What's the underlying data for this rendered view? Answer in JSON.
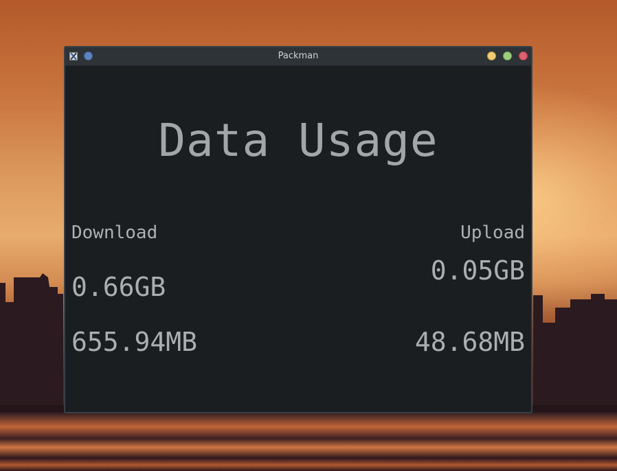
{
  "window": {
    "title": "Packman"
  },
  "main": {
    "heading": "Data Usage",
    "download": {
      "label": "Download",
      "gb": "0.66GB",
      "mb": "655.94MB"
    },
    "upload": {
      "label": "Upload",
      "gb": "0.05GB",
      "mb": "48.68MB"
    }
  },
  "icons": {
    "app": "app-icon",
    "pin": "pin-icon",
    "minimize": "minimize-icon",
    "maximize": "maximize-icon",
    "close": "close-icon"
  },
  "colors": {
    "window_bg": "#1b1e21",
    "titlebar_bg": "#2e3338",
    "text": "#a9acaf",
    "minimize": "#f0cb71",
    "maximize": "#9bcf7e",
    "close": "#e06070",
    "pin": "#5b83c0"
  }
}
